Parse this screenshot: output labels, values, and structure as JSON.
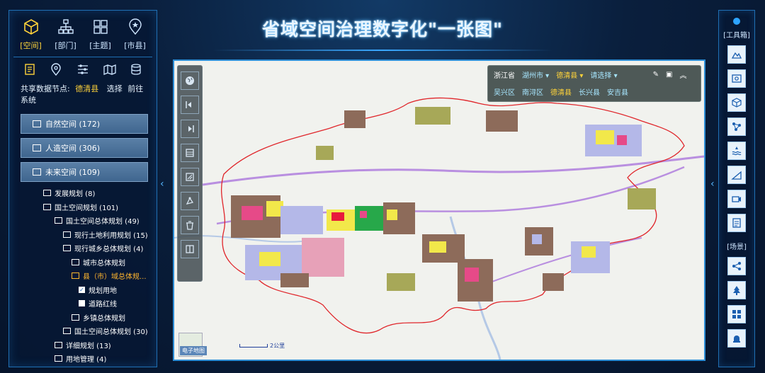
{
  "header": {
    "title": "省域空间治理数字化\"一张图\""
  },
  "left": {
    "categories": [
      {
        "label": "[空间]",
        "icon": "cube-icon",
        "active": true
      },
      {
        "label": "[部门]",
        "icon": "org-chart-icon",
        "active": false
      },
      {
        "label": "[主题]",
        "icon": "grid-icon",
        "active": false
      },
      {
        "label": "[市县]",
        "icon": "map-pin-icon",
        "active": false
      }
    ],
    "tools": [
      "document-icon",
      "location-icon",
      "sliders-icon",
      "map-icon",
      "database-icon"
    ],
    "share": {
      "label": "共享数据节点:",
      "node": "德清县",
      "select": "选择",
      "goto": "前往系统"
    },
    "sections": [
      {
        "label": "自然空间 (172)"
      },
      {
        "label": "人造空间 (306)"
      },
      {
        "label": "未来空间 (109)"
      }
    ],
    "tree": [
      {
        "label": "发展规划 (8)",
        "type": "folder",
        "level": 1
      },
      {
        "label": "国土空间规划 (101)",
        "type": "folder",
        "level": 1
      },
      {
        "label": "国土空间总体规划 (49)",
        "type": "folder",
        "level": 2
      },
      {
        "label": "现行土地利用规划 (15)",
        "type": "folder",
        "level": 3
      },
      {
        "label": "现行城乡总体规划 (4)",
        "type": "folder",
        "level": 3
      },
      {
        "label": "城市总体规划",
        "type": "folder",
        "level": 4
      },
      {
        "label": "县（市）域总体规...",
        "type": "folder",
        "level": 4,
        "selected": true
      },
      {
        "label": "规划用地",
        "type": "check",
        "level": 5,
        "checked": true
      },
      {
        "label": "道路红线",
        "type": "check",
        "level": 5,
        "checked": false
      },
      {
        "label": "乡镇总体规划",
        "type": "folder",
        "level": 4
      },
      {
        "label": "国土空间总体规划 (30)",
        "type": "folder",
        "level": 3
      },
      {
        "label": "详细规划 (13)",
        "type": "folder",
        "level": 2
      },
      {
        "label": "用地管理 (4)",
        "type": "folder",
        "level": 2
      }
    ]
  },
  "map": {
    "toolbar": [
      "globe-icon",
      "back-icon",
      "forward-icon",
      "layers-icon",
      "measure-icon",
      "draw-icon",
      "clear-icon",
      "split-icon"
    ],
    "region": {
      "province": "浙江省",
      "city": "湖州市",
      "county": "德清县",
      "select": "请选择",
      "districts": [
        "吴兴区",
        "南浔区",
        "德清县",
        "长兴县",
        "安吉县"
      ]
    },
    "minimap_label": "电子地图",
    "scale_label": "2公里"
  },
  "right": {
    "toolbox_label": "[工具箱]",
    "tools": [
      "terrain-icon",
      "photo-icon",
      "cube-scan-icon",
      "network-icon",
      "flood-icon",
      "chart-slope-icon",
      "camera-icon",
      "list-icon"
    ],
    "scene_label": "[场景]",
    "scenes": [
      "share-icon",
      "tree-icon",
      "windows-icon",
      "alarm-icon"
    ]
  },
  "colors": {
    "accent": "#2d8ed6",
    "highlight": "#ffd33a",
    "selected": "#ffb52e",
    "boundary": "#e0262b"
  }
}
